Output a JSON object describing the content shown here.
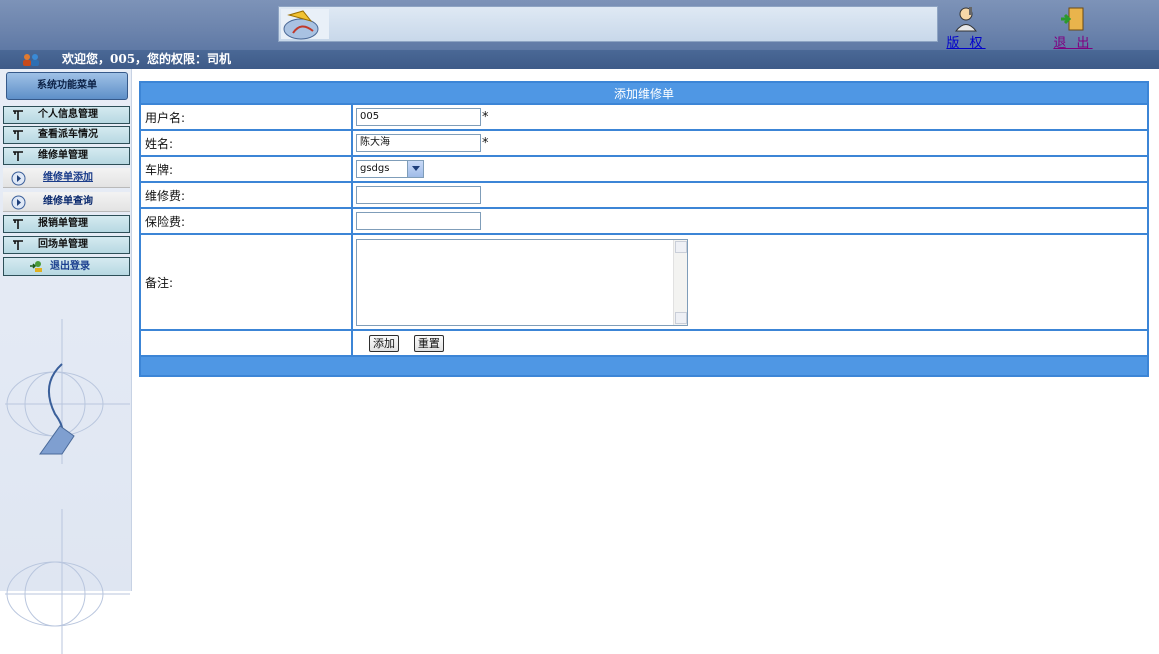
{
  "header": {
    "copyright_label": "版 权",
    "exit_label": "退 出"
  },
  "welcome": {
    "text": "欢迎您，005，您的权限：司机"
  },
  "sidebar": {
    "menu_title": "系统功能菜单",
    "items": [
      {
        "label": "个人信息管理",
        "icon": "tool-icon"
      },
      {
        "label": "查看派车情况",
        "icon": "tool-icon"
      },
      {
        "label": "维修单管理",
        "icon": "tool-icon"
      }
    ],
    "subitems": [
      {
        "label": "维修单添加",
        "icon": "arrow-right-icon",
        "active": true
      },
      {
        "label": "维修单查询",
        "icon": "arrow-right-icon",
        "active": false
      }
    ],
    "items2": [
      {
        "label": "报销单管理",
        "icon": "tool-icon"
      },
      {
        "label": "回场单管理",
        "icon": "tool-icon"
      }
    ],
    "logout_label": "退出登录"
  },
  "form": {
    "title": "添加维修单",
    "fields": {
      "username": {
        "label": "用户名:",
        "value": "005",
        "required": "*"
      },
      "name": {
        "label": "姓名:",
        "value": "陈大海",
        "required": "*"
      },
      "plate": {
        "label": "车牌:",
        "value": "gsdgs"
      },
      "repair_fee": {
        "label": "维修费:",
        "value": ""
      },
      "insurance_fee": {
        "label": "保险费:",
        "value": ""
      },
      "remark": {
        "label": "备注:",
        "value": ""
      }
    },
    "buttons": {
      "add": "添加",
      "reset": "重置"
    }
  },
  "colors": {
    "accent": "#4f97e4",
    "border": "#3c85d6",
    "topbar": "#6c84ad"
  }
}
